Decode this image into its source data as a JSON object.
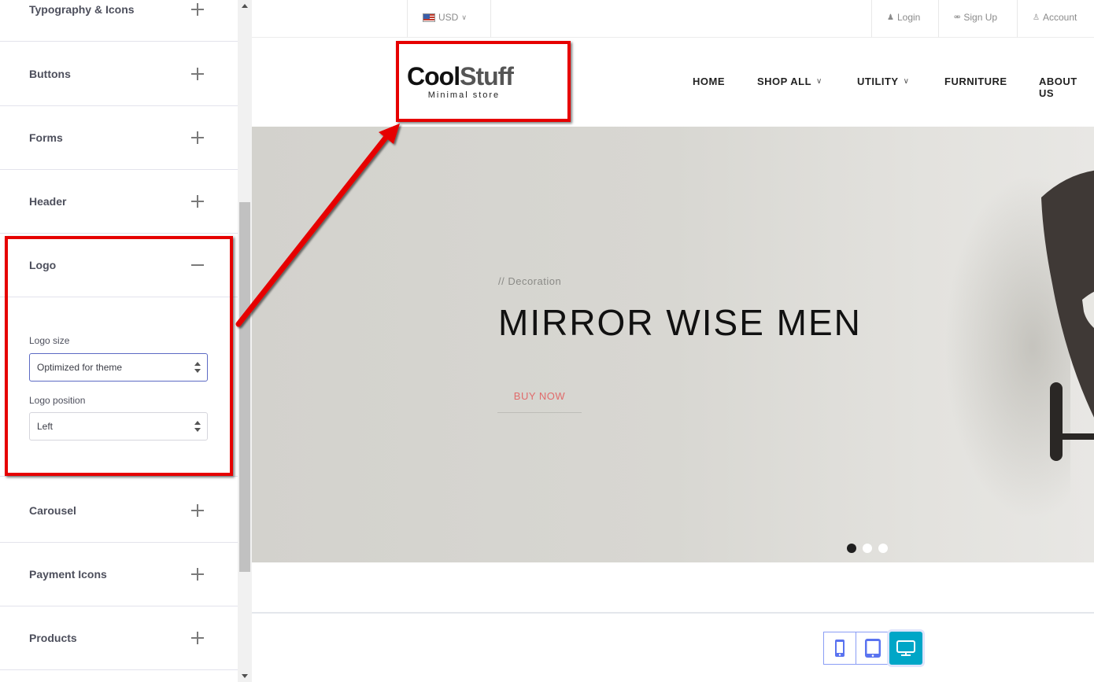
{
  "sidebar": {
    "sections": [
      {
        "label": "Typography & Icons",
        "expanded": false
      },
      {
        "label": "Buttons",
        "expanded": false
      },
      {
        "label": "Forms",
        "expanded": false
      },
      {
        "label": "Header",
        "expanded": false
      },
      {
        "label": "Logo",
        "expanded": true
      },
      {
        "label": "Carousel",
        "expanded": false
      },
      {
        "label": "Payment Icons",
        "expanded": false
      },
      {
        "label": "Products",
        "expanded": false
      }
    ],
    "logo_panel": {
      "logo_size_label": "Logo size",
      "logo_size_value": "Optimized for theme",
      "logo_position_label": "Logo position",
      "logo_position_value": "Left"
    }
  },
  "store": {
    "topbar": {
      "currency": "USD",
      "login": "Login",
      "signup": "Sign Up",
      "account": "Account"
    },
    "logo": {
      "brand_part1": "Cool",
      "brand_part2": "Stuff",
      "tagline": "Minimal store"
    },
    "nav": [
      {
        "label": "HOME",
        "has_dropdown": false
      },
      {
        "label": "SHOP ALL",
        "has_dropdown": true
      },
      {
        "label": "UTILITY",
        "has_dropdown": true
      },
      {
        "label": "FURNITURE",
        "has_dropdown": false
      },
      {
        "label": "ABOUT US",
        "has_dropdown": false
      }
    ],
    "hero": {
      "subtitle": "// Decoration",
      "title": "MIRROR WISE MEN",
      "button": "BUY NOW",
      "slides": 3,
      "active_slide": 1
    }
  },
  "device_toggle": {
    "options": [
      "mobile",
      "tablet",
      "desktop"
    ],
    "active": "desktop"
  },
  "colors": {
    "annotation_red": "#e60000",
    "active_device": "#00a6c7",
    "buy_now": "#e06b6b"
  }
}
